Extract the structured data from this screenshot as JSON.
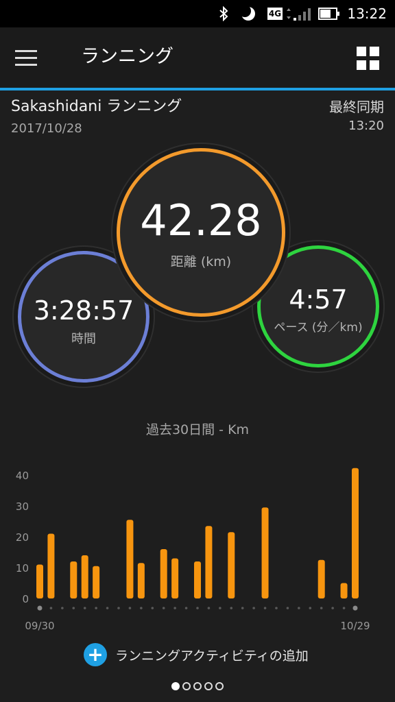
{
  "status_bar": {
    "time": "13:22",
    "network": "4G",
    "icons": [
      "bluetooth-icon",
      "moon-icon",
      "signal-icon",
      "battery-icon"
    ]
  },
  "app_bar": {
    "title": "ランニング",
    "icons": [
      "menu-icon",
      "grid-icon"
    ]
  },
  "device": {
    "name": "Sakashidani ランニング",
    "date": "2017/10/28",
    "sync_label": "最終同期",
    "sync_time": "13:20"
  },
  "stats": {
    "distance": {
      "value": "42.28",
      "label": "距離 (km)",
      "color": "#f39a2c"
    },
    "time": {
      "value": "3:28:57",
      "label": "時間",
      "color": "#6c7fd6"
    },
    "pace": {
      "value": "4:57",
      "label": "ペース (分／km)",
      "color": "#2ed43f"
    }
  },
  "chart_title": "過去30日間 - Km",
  "chart_data": {
    "type": "bar",
    "ylim": [
      0,
      40
    ],
    "yticks": [
      0,
      10,
      20,
      30,
      40
    ],
    "x_start_label": "09/30",
    "x_end_label": "10/29",
    "bar_color": "#f7950f",
    "values": [
      11,
      21,
      0,
      12,
      14,
      10.5,
      0,
      0,
      25.5,
      11.5,
      0,
      16,
      13,
      0,
      12,
      23.5,
      0,
      21.5,
      0,
      0,
      29.5,
      0,
      0,
      0,
      0,
      12.5,
      0,
      5,
      42.28
    ]
  },
  "add_activity": {
    "label": "ランニングアクティビティの追加",
    "icon": "plus-icon"
  },
  "pager": {
    "pages": 5,
    "active": 0
  }
}
